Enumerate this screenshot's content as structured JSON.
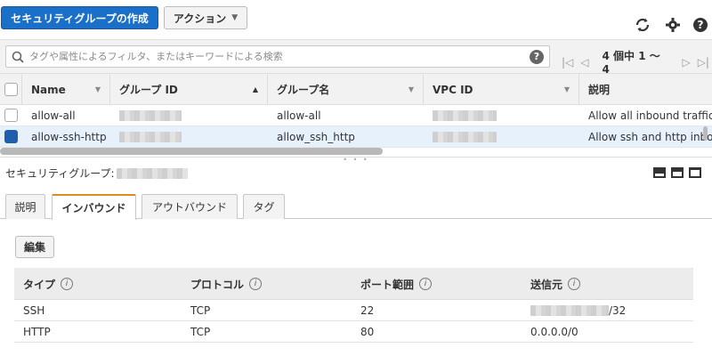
{
  "toolbar": {
    "create_label": "セキュリティグループの作成",
    "actions_label": "アクション",
    "refresh_icon": "refresh-icon",
    "settings_icon": "gear-icon",
    "help_icon": "help-icon"
  },
  "search": {
    "placeholder": "タグや属性によるフィルタ、またはキーワードによる検索",
    "help_glyph": "?"
  },
  "pager": {
    "text": "4 個中 1 〜 4"
  },
  "table": {
    "headers": [
      "Name",
      "グループ ID",
      "グループ名",
      "VPC ID",
      "説明"
    ],
    "rows": [
      {
        "name": "allow-all",
        "group_name": "allow-all",
        "description": "Allow all inbound traffic",
        "selected": false
      },
      {
        "name": "allow-ssh-http",
        "group_name": "allow_ssh_http",
        "description": "Allow ssh and http inbound",
        "selected": true
      }
    ]
  },
  "detail": {
    "title_prefix": "セキュリティグループ:"
  },
  "tabs": [
    {
      "label": "説明",
      "active": false
    },
    {
      "label": "インバウンド",
      "active": true
    },
    {
      "label": "アウトバウンド",
      "active": false
    },
    {
      "label": "タグ",
      "active": false
    }
  ],
  "edit_label": "編集",
  "rules": {
    "headers": [
      "タイプ",
      "プロトコル",
      "ポート範囲",
      "送信元"
    ],
    "info_glyph": "i",
    "rows": [
      {
        "type": "SSH",
        "protocol": "TCP",
        "port": "22",
        "source_suffix": "/32"
      },
      {
        "type": "HTTP",
        "protocol": "TCP",
        "port": "80",
        "source": "0.0.0.0/0"
      }
    ]
  },
  "colors": {
    "primary": "#1a6fc9",
    "tab_accent": "#e08a1e",
    "selected_row": "#e7f1fc"
  }
}
